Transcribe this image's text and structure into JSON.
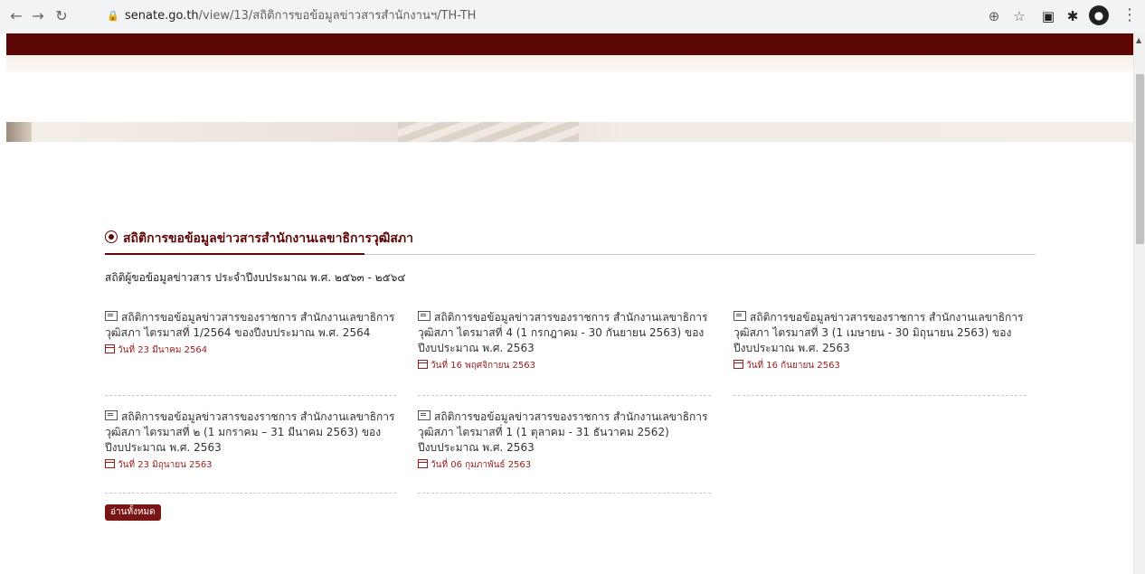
{
  "browser": {
    "url_host": "senate.go.th",
    "url_path": "/view/13/สถิติการขอข้อมูลข่าวสารสำนักงานฯ/TH-TH"
  },
  "section": {
    "heading": "สถิติการขอข้อมูลข่าวสารสำนักงานเลขาธิการวุฒิสภา",
    "subtitle": "สถิติผู้ขอข้อมูลข่าวสาร ประจำปีงบประมาณ พ.ศ. ๒๕๖๓ - ๒๕๖๔"
  },
  "items": [
    {
      "title": "สถิติการขอข้อมูลข่าวสารของราชการ สำนักงานเลขาธิการวุฒิสภา ไตรมาสที่ 1/2564 ของปีงบประมาณ พ.ศ. 2564",
      "date": "วันที่ 23 มีนาคม 2564"
    },
    {
      "title": "สถิติการขอข้อมูลข่าวสารของราชการ สำนักงานเลขาธิการวุฒิสภา ไตรมาสที่ 4 (1 กรกฎาคม - 30 กันยายน 2563) ของปีงบประมาณ พ.ศ. 2563",
      "date": "วันที่ 16 พฤศจิกายน 2563"
    },
    {
      "title": "สถิติการขอข้อมูลข่าวสารของราชการ สำนักงานเลขาธิการวุฒิสภา ไตรมาสที่ 3 (1 เมษายน - 30 มิถุนายน 2563) ของปีงบประมาณ พ.ศ. 2563",
      "date": "วันที่ 16 กันยายน 2563"
    },
    {
      "title": "สถิติการขอข้อมูลข่าวสารของราชการ สำนักงานเลขาธิการวุฒิสภา ไตรมาสที่ ๒ (1 มกราคม – 31 มีนาคม 2563) ของปีงบประมาณ พ.ศ. 2563",
      "date": "วันที่ 23 มิถุนายน 2563"
    },
    {
      "title": "สถิติการขอข้อมูลข่าวสารของราชการ สำนักงานเลขาธิการวุฒิสภา ไตรมาสที่ 1 (1 ตุลาคม - 31 ธันวาคม 2562) ปีงบประมาณ พ.ศ. 2563",
      "date": "วันที่ 06 กุมภาพันธ์ 2563"
    }
  ],
  "read_all_label": "อ่านทั้งหมด"
}
